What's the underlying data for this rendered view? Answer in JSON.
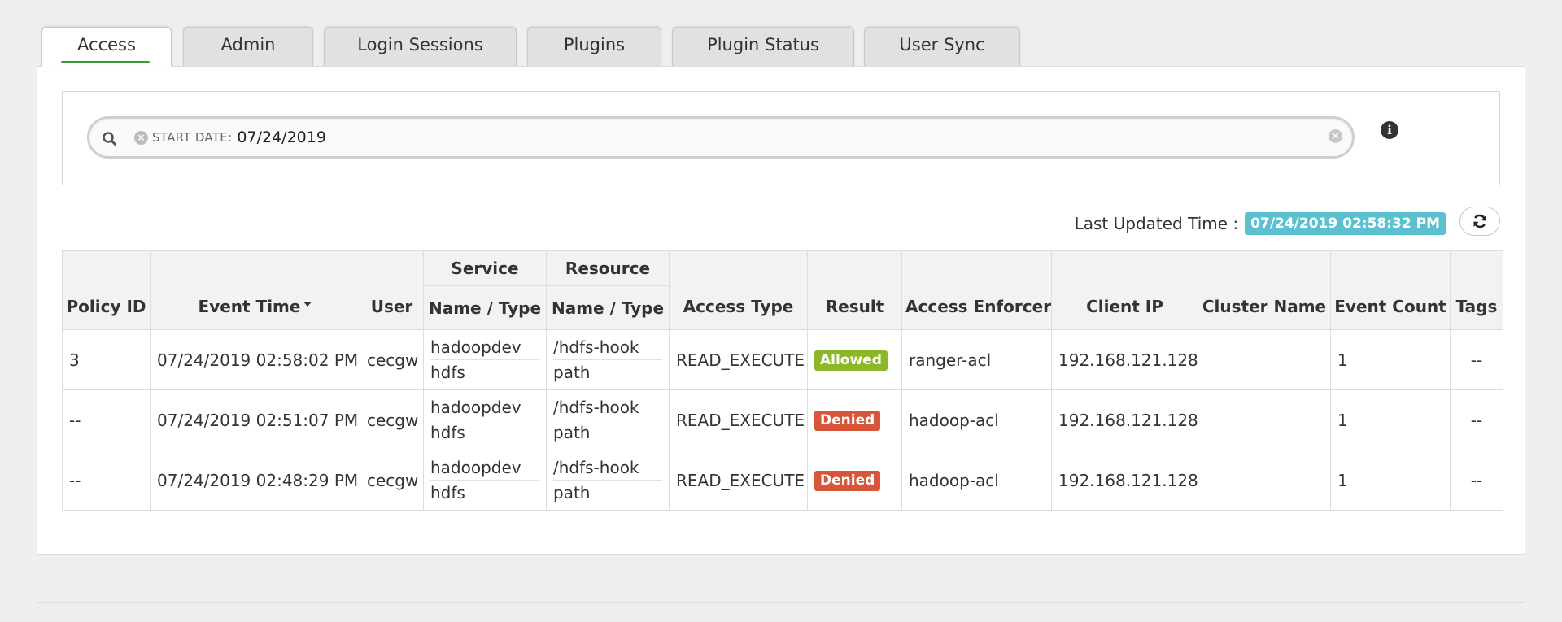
{
  "tabs": [
    {
      "label": "Access",
      "active": true
    },
    {
      "label": "Admin",
      "active": false
    },
    {
      "label": "Login Sessions",
      "active": false
    },
    {
      "label": "Plugins",
      "active": false
    },
    {
      "label": "Plugin Status",
      "active": false
    },
    {
      "label": "User Sync",
      "active": false
    }
  ],
  "search": {
    "facet_label": "START DATE:",
    "facet_value": "07/24/2019"
  },
  "last_updated": {
    "label": "Last Updated Time :",
    "value": "07/24/2019 02:58:32 PM"
  },
  "table": {
    "headers": {
      "policy_id": "Policy ID",
      "event_time": "Event Time",
      "user": "User",
      "service": "Service",
      "resource": "Resource",
      "service_name_type": "Name / Type",
      "resource_name_type": "Name / Type",
      "access_type": "Access Type",
      "result": "Result",
      "access_enforcer": "Access Enforcer",
      "client_ip": "Client IP",
      "cluster_name": "Cluster Name",
      "event_count": "Event Count",
      "tags": "Tags"
    },
    "rows": [
      {
        "policy_id": "3",
        "event_time": "07/24/2019 02:58:02 PM",
        "user": "cecgw",
        "service_name": "hadoopdev",
        "service_type": "hdfs",
        "resource_name": "/hdfs-hook",
        "resource_type": "path",
        "access_type": "READ_EXECUTE",
        "result": "Allowed",
        "access_enforcer": "ranger-acl",
        "client_ip": "192.168.121.128",
        "cluster_name": "",
        "event_count": "1",
        "tags": "--"
      },
      {
        "policy_id": "--",
        "event_time": "07/24/2019 02:51:07 PM",
        "user": "cecgw",
        "service_name": "hadoopdev",
        "service_type": "hdfs",
        "resource_name": "/hdfs-hook",
        "resource_type": "path",
        "access_type": "READ_EXECUTE",
        "result": "Denied",
        "access_enforcer": "hadoop-acl",
        "client_ip": "192.168.121.128",
        "cluster_name": "",
        "event_count": "1",
        "tags": "--"
      },
      {
        "policy_id": "--",
        "event_time": "07/24/2019 02:48:29 PM",
        "user": "cecgw",
        "service_name": "hadoopdev",
        "service_type": "hdfs",
        "resource_name": "/hdfs-hook",
        "resource_type": "path",
        "access_type": "READ_EXECUTE",
        "result": "Denied",
        "access_enforcer": "hadoop-acl",
        "client_ip": "192.168.121.128",
        "cluster_name": "",
        "event_count": "1",
        "tags": "--"
      }
    ]
  },
  "colors": {
    "accent_green": "#3f9a36",
    "allowed": "#8cb827",
    "denied": "#d8553a",
    "timestamp_badge": "#5bc0cf"
  }
}
